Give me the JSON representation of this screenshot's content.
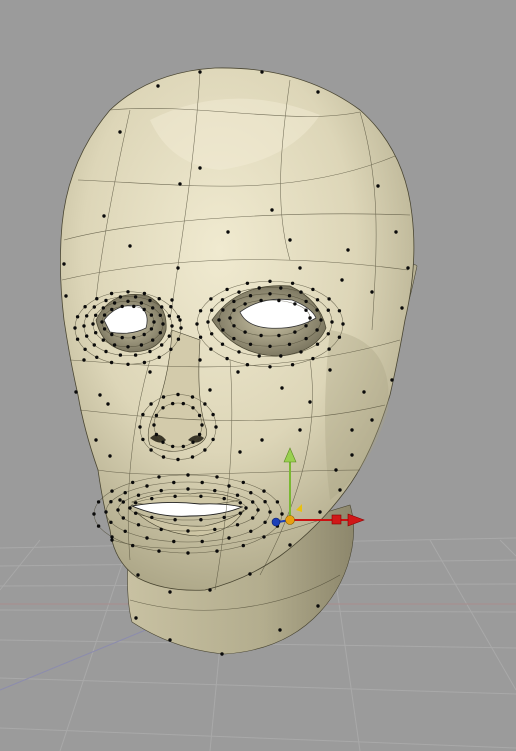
{
  "viewport": {
    "background": "#9b9b9b",
    "grid_color": "#a6a6a6",
    "grid_axis_x_color": "#a88c8c",
    "grid_axis_z_color": "#8c8cad"
  },
  "mesh": {
    "fill": "#d9d2b4",
    "edge_color": "#4a4632",
    "vertex_color": "#0a0a0a"
  },
  "gizmo": {
    "x_axis_color": "#cc1010",
    "y_axis_color": "#7ab832",
    "z_axis_color": "#1c3fb8",
    "pivot_color": "#e8a010",
    "x_axis_icon": "move-x-arrow-icon",
    "y_axis_icon": "move-y-arrow-icon",
    "z_axis_icon": "move-z-handle-icon",
    "scale_handle_icon": "scale-x-handle-icon"
  }
}
